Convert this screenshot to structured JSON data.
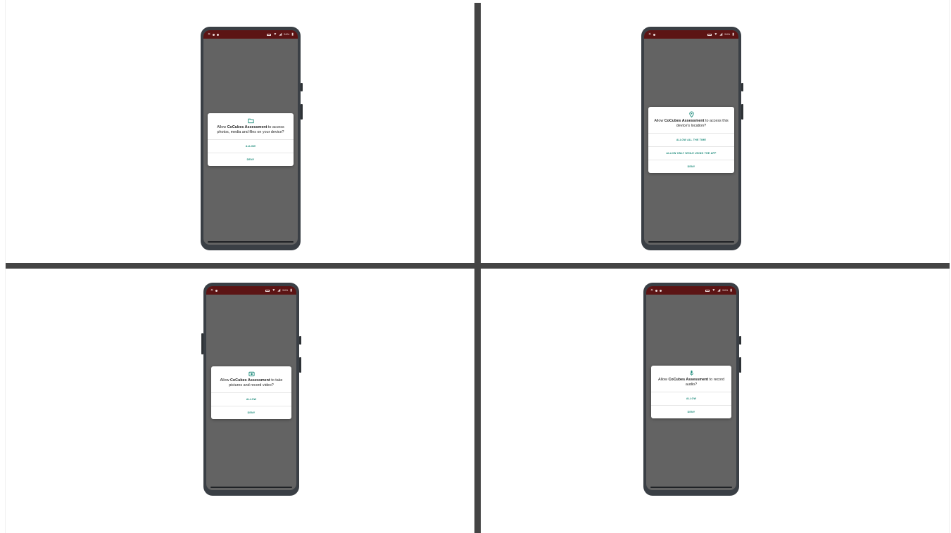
{
  "app_name": "CoCubes Assessment",
  "colors": {
    "accent": "#1b8a7a",
    "status_bar": "#5c1414",
    "divider": "#444444",
    "screen_dim": "#636363"
  },
  "statusbar": {
    "battery_pct": "54%"
  },
  "panels": [
    {
      "icon": "folder-icon",
      "pre": "Allow ",
      "post": " to access photos, media and files on your device?",
      "buttons": [
        "ALLOW",
        "DENY"
      ]
    },
    {
      "icon": "location-pin-icon",
      "pre": "Allow ",
      "post": " to access this device's location?",
      "buttons": [
        "ALLOW ALL THE TIME",
        "ALLOW ONLY WHILE USING THE APP",
        "DENY"
      ]
    },
    {
      "icon": "camera-icon",
      "pre": "Allow ",
      "post": " to take pictures and record video?",
      "buttons": [
        "ALLOW",
        "DENY"
      ]
    },
    {
      "icon": "microphone-icon",
      "pre": "Allow ",
      "post": " to record audio?",
      "buttons": [
        "ALLOW",
        "DENY"
      ]
    }
  ]
}
